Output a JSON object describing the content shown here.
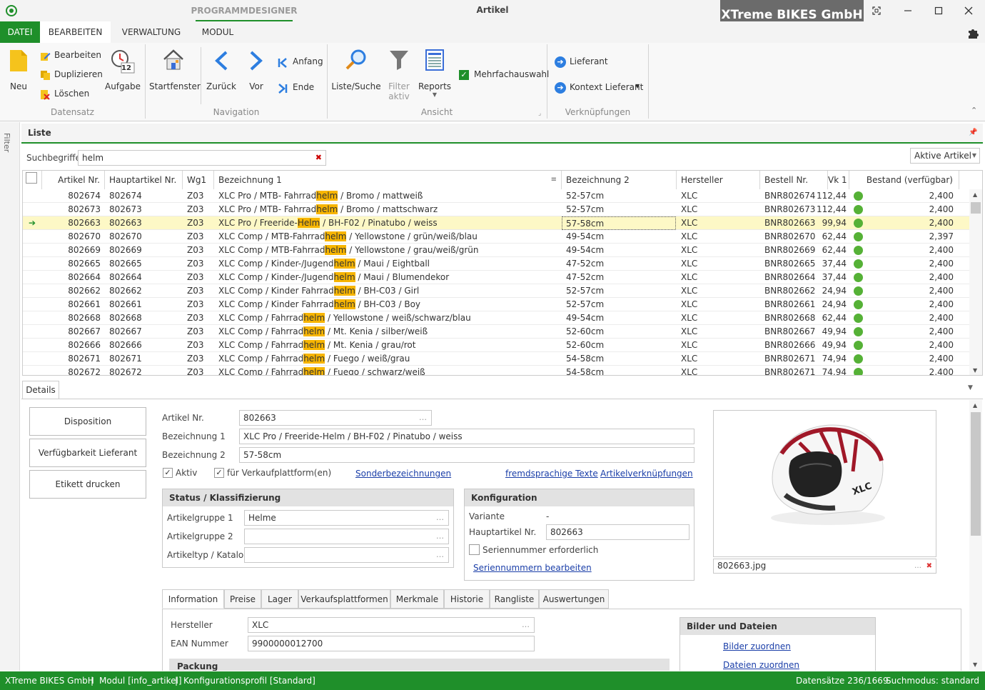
{
  "titlebar": {
    "designer_tab": "PROGRAMMDESIGNER",
    "window_title": "Artikel",
    "company": "XTreme BIKES GmbH"
  },
  "menu": {
    "datei": "DATEI",
    "bearbeiten": "BEARBEITEN",
    "verwaltung": "VERWALTUNG",
    "modul": "MODUL"
  },
  "ribbon": {
    "datensatz": {
      "neu": "Neu",
      "bearbeiten": "Bearbeiten",
      "duplizieren": "Duplizieren",
      "loeschen": "Löschen",
      "aufgabe": "Aufgabe",
      "aufgabe_day": "12",
      "group": "Datensatz"
    },
    "navigation": {
      "startfenster": "Startfenster",
      "zurueck": "Zurück",
      "vor": "Vor",
      "anfang": "Anfang",
      "ende": "Ende",
      "group": "Navigation"
    },
    "ansicht": {
      "liste_suche": "Liste/Suche",
      "filter_1": "Filter",
      "filter_2": "aktiv",
      "reports": "Reports",
      "mehrfachauswahl": "Mehrfachauswahl",
      "group": "Ansicht"
    },
    "verknuepfungen": {
      "lieferant": "Lieferant",
      "kontext_lieferant": "Kontext Lieferant",
      "group": "Verknüpfungen"
    }
  },
  "sidebar": {
    "filter": "Filter"
  },
  "liste": {
    "title": "Liste",
    "search_label": "Suchbegriffe",
    "search_value": "helm",
    "filter_select": "Aktive Artikel",
    "columns": [
      "Artikel Nr.",
      "Hauptartikel Nr.",
      "Wg1",
      "Bezeichnung 1",
      "Bezeichnung 2",
      "Hersteller",
      "Bestell Nr.",
      "Vk 1",
      "Bestand (verfügbar)"
    ],
    "rows": [
      {
        "nr": "802674",
        "haupt": "802674",
        "wg": "Z03",
        "b_pre": "XLC Pro / MTB- Fahrrad",
        "b_hl": "helm",
        "b_post": " / Bromo /  mattweiß",
        "b2": "52-57cm",
        "hersteller": "XLC",
        "bestell": "BNR802674",
        "vk": "112,44",
        "bestand": "2,400"
      },
      {
        "nr": "802673",
        "haupt": "802673",
        "wg": "Z03",
        "b_pre": "XLC Pro / MTB- Fahrrad",
        "b_hl": "helm",
        "b_post": " / Bromo /  mattschwarz",
        "b2": "52-57cm",
        "hersteller": "XLC",
        "bestell": "BNR802673",
        "vk": "112,44",
        "bestand": "2,400"
      },
      {
        "nr": "802663",
        "haupt": "802663",
        "wg": "Z03",
        "b_pre": "XLC Pro / Freeride-",
        "b_hl": "Helm",
        "b_post": " / BH-F02 / Pinatubo / weiss",
        "b2": "57-58cm",
        "hersteller": "XLC",
        "bestell": "BNR802663",
        "vk": "99,94",
        "bestand": "2,400"
      },
      {
        "nr": "802670",
        "haupt": "802670",
        "wg": "Z03",
        "b_pre": "XLC Comp / MTB-Fahrrad",
        "b_hl": "helm",
        "b_post": " / Yellowstone / grün/weiß/blau",
        "b2": "49-54cm",
        "hersteller": "XLC",
        "bestell": "BNR802670",
        "vk": "62,44",
        "bestand": "2,397"
      },
      {
        "nr": "802669",
        "haupt": "802669",
        "wg": "Z03",
        "b_pre": "XLC Comp / MTB-Fahrrad",
        "b_hl": "helm",
        "b_post": " / Yellowstone / grau/weiß/grün",
        "b2": "49-54cm",
        "hersteller": "XLC",
        "bestell": "BNR802669",
        "vk": "62,44",
        "bestand": "2,400"
      },
      {
        "nr": "802665",
        "haupt": "802665",
        "wg": "Z03",
        "b_pre": "XLC Comp / Kinder-/Jugend",
        "b_hl": "helm",
        "b_post": " / Maui / Eightball",
        "b2": "47-52cm",
        "hersteller": "XLC",
        "bestell": "BNR802665",
        "vk": "37,44",
        "bestand": "2,400"
      },
      {
        "nr": "802664",
        "haupt": "802664",
        "wg": "Z03",
        "b_pre": "XLC Comp / Kinder-/Jugend",
        "b_hl": "helm",
        "b_post": " / Maui / Blumendekor",
        "b2": "47-52cm",
        "hersteller": "XLC",
        "bestell": "BNR802664",
        "vk": "37,44",
        "bestand": "2,400"
      },
      {
        "nr": "802662",
        "haupt": "802662",
        "wg": "Z03",
        "b_pre": "XLC Comp / Kinder Fahrrad",
        "b_hl": "helm",
        "b_post": " / BH-C03 / Girl",
        "b2": "52-57cm",
        "hersteller": "XLC",
        "bestell": "BNR802662",
        "vk": "24,94",
        "bestand": "2,400"
      },
      {
        "nr": "802661",
        "haupt": "802661",
        "wg": "Z03",
        "b_pre": "XLC Comp / Kinder Fahrrad",
        "b_hl": "helm",
        "b_post": " / BH-C03 / Boy",
        "b2": "52-57cm",
        "hersteller": "XLC",
        "bestell": "BNR802661",
        "vk": "24,94",
        "bestand": "2,400"
      },
      {
        "nr": "802668",
        "haupt": "802668",
        "wg": "Z03",
        "b_pre": "XLC Comp / Fahrrad",
        "b_hl": "helm",
        "b_post": " / Yellowstone / weiß/schwarz/blau",
        "b2": "49-54cm",
        "hersteller": "XLC",
        "bestell": "BNR802668",
        "vk": "62,44",
        "bestand": "2,400"
      },
      {
        "nr": "802667",
        "haupt": "802667",
        "wg": "Z03",
        "b_pre": "XLC Comp / Fahrrad",
        "b_hl": "helm",
        "b_post": " / Mt. Kenia / silber/weiß",
        "b2": "52-60cm",
        "hersteller": "XLC",
        "bestell": "BNR802667",
        "vk": "49,94",
        "bestand": "2,400"
      },
      {
        "nr": "802666",
        "haupt": "802666",
        "wg": "Z03",
        "b_pre": "XLC Comp / Fahrrad",
        "b_hl": "helm",
        "b_post": " / Mt. Kenia / grau/rot",
        "b2": "52-60cm",
        "hersteller": "XLC",
        "bestell": "BNR802666",
        "vk": "49,94",
        "bestand": "2,400"
      },
      {
        "nr": "802671",
        "haupt": "802671",
        "wg": "Z03",
        "b_pre": "XLC Comp / Fahrrad",
        "b_hl": "helm",
        "b_post": " / Fuego / weiß/grau",
        "b2": "54-58cm",
        "hersteller": "XLC",
        "bestell": "BNR802671",
        "vk": "74,94",
        "bestand": "2,400"
      },
      {
        "nr": "802672",
        "haupt": "802672",
        "wg": "Z03",
        "b_pre": "XLC Comp / Fahrrad",
        "b_hl": "helm",
        "b_post": " / Fuego /  schwarz/weiß",
        "b2": "54-58cm",
        "hersteller": "XLC",
        "bestell": "BNR802671",
        "vk": "74,94",
        "bestand": "2,400"
      }
    ],
    "selected_row": 2
  },
  "details": {
    "tab": "Details",
    "buttons": {
      "disposition": "Disposition",
      "verfuegbarkeit": "Verfügbarkeit Lieferant",
      "etikett": "Etikett drucken"
    },
    "artikel_nr_label": "Artikel Nr.",
    "artikel_nr": "802663",
    "bez1_label": "Bezeichnung 1",
    "bez1": "XLC Pro / Freeride-Helm / BH-F02 / Pinatubo / weiss",
    "bez2_label": "Bezeichnung 2",
    "bez2": "57-58cm",
    "aktiv_label": "Aktiv",
    "verkauf_label": "für Verkaufplattform(en)",
    "link_sonder": "Sonderbezeichnungen",
    "link_fremd": "fremdsprachige Texte",
    "link_verkn": "Artikelverknüpfungen",
    "status": {
      "title": "Status / Klassifizierung",
      "ag1_label": "Artikelgruppe 1",
      "ag1": "Helme",
      "ag2_label": "Artikelgruppe 2",
      "typ_label": "Artikeltyp / Katalog"
    },
    "konfig": {
      "title": "Konfiguration",
      "variante_label": "Variante",
      "variante": "-",
      "haupt_label": "Hauptartikel Nr.",
      "haupt": "802663",
      "serien_label": "Seriennummer erforderlich",
      "serien_link": "Seriennummern bearbeiten"
    },
    "image_file": "802663.jpg",
    "image_brand": "XLC",
    "tabs": [
      "Information",
      "Preise",
      "Lager",
      "Verkaufsplattformen",
      "Merkmale",
      "Historie",
      "Rangliste",
      "Auswertungen"
    ],
    "info": {
      "hersteller_label": "Hersteller",
      "hersteller": "XLC",
      "ean_label": "EAN Nummer",
      "ean": "9900000012700",
      "packung": "Packung"
    },
    "bilder": {
      "title": "Bilder und Dateien",
      "bilder_link": "Bilder zuordnen",
      "dateien_link": "Dateien zuordnen"
    }
  },
  "statusbar": {
    "company": "XTreme BIKES GmbH",
    "sep1": "|",
    "modul": "Modul [info_artikel]",
    "sep2": "|",
    "profil": "Konfigurationsprofil [Standard]",
    "datensaetze": "Datensätze 236/1669",
    "suchmodus": "Suchmodus: standard"
  },
  "colors": {
    "accent": "#1f8f2a",
    "highlight": "#f7b500",
    "selected_row": "#fdf8c6",
    "stock_ok": "#55b136",
    "link": "#1a3ea8"
  }
}
